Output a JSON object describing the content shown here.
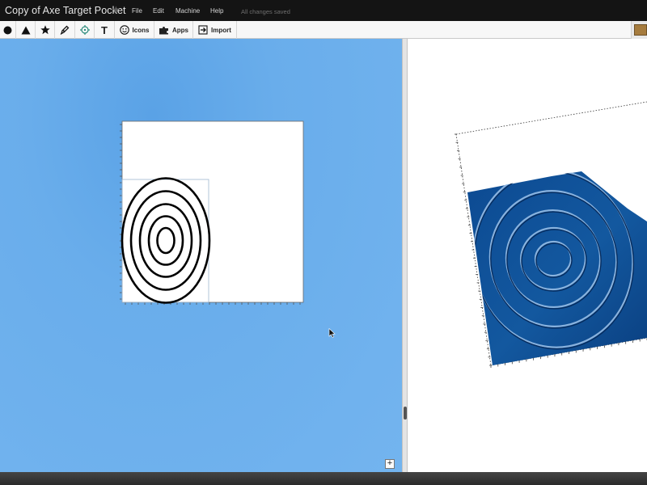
{
  "app": {
    "document_title": "Copy of Axe Target Pocket",
    "save_status": "All changes saved"
  },
  "menu": [
    {
      "label": "File"
    },
    {
      "label": "Edit"
    },
    {
      "label": "Machine"
    },
    {
      "label": "Help"
    }
  ],
  "toolbar": {
    "tools": [
      {
        "name": "circle",
        "icon": "circle-icon"
      },
      {
        "name": "triangle",
        "icon": "triangle-icon"
      },
      {
        "name": "star",
        "icon": "star-icon"
      },
      {
        "name": "pen",
        "icon": "pen-icon"
      },
      {
        "name": "target",
        "icon": "crosshair-icon"
      },
      {
        "name": "text",
        "icon": "text-icon",
        "glyph": "T"
      },
      {
        "name": "icons",
        "icon": "smiley-icon",
        "label": "Icons"
      },
      {
        "name": "apps",
        "icon": "puzzle-icon",
        "label": "Apps"
      },
      {
        "name": "import",
        "icon": "import-icon",
        "label": "Import"
      }
    ]
  },
  "material": {
    "color": "#a67c3e"
  },
  "canvas": {
    "background_color": "#73b4ef",
    "zoom_in_label": "+"
  },
  "design": {
    "target_rings": 5
  },
  "preview": {
    "material_color": "#0f4f98"
  }
}
